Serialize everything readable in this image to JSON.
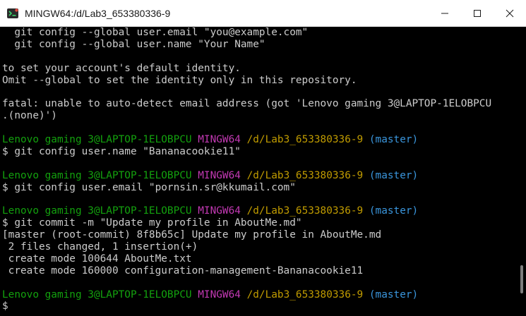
{
  "window": {
    "title": "MINGW64:/d/Lab3_653380336-9"
  },
  "terminal": {
    "lines": [
      {
        "text": "  git config --global user.email \"you@example.com\""
      },
      {
        "text": "  git config --global user.name \"Your Name\""
      },
      {
        "text": ""
      },
      {
        "text": "to set your account's default identity."
      },
      {
        "text": "Omit --global to set the identity only in this repository."
      },
      {
        "text": ""
      },
      {
        "text": "fatal: unable to auto-detect email address (got 'Lenovo gaming 3@LAPTOP-1ELOBPCU"
      },
      {
        "text": ".(none)')"
      },
      {
        "text": ""
      },
      {
        "prompt": {
          "user": "Lenovo gaming 3@LAPTOP-1ELOBPCU",
          "system": "MINGW64",
          "path": "/d/Lab3_653380336-9",
          "branch": "(master)"
        }
      },
      {
        "text": "$ git config user.name \"Bananacookie11\""
      },
      {
        "text": ""
      },
      {
        "prompt": {
          "user": "Lenovo gaming 3@LAPTOP-1ELOBPCU",
          "system": "MINGW64",
          "path": "/d/Lab3_653380336-9",
          "branch": "(master)"
        }
      },
      {
        "text": "$ git config user.email \"pornsin.sr@kkumail.com\""
      },
      {
        "text": ""
      },
      {
        "prompt": {
          "user": "Lenovo gaming 3@LAPTOP-1ELOBPCU",
          "system": "MINGW64",
          "path": "/d/Lab3_653380336-9",
          "branch": "(master)"
        }
      },
      {
        "text": "$ git commit -m \"Update my profile in AboutMe.md\""
      },
      {
        "text": "[master (root-commit) 8f8b65c] Update my profile in AboutMe.md"
      },
      {
        "text": " 2 files changed, 1 insertion(+)"
      },
      {
        "text": " create mode 100644 AboutMe.txt"
      },
      {
        "text": " create mode 160000 configuration-management-Bananacookie11"
      },
      {
        "text": ""
      },
      {
        "prompt": {
          "user": "Lenovo gaming 3@LAPTOP-1ELOBPCU",
          "system": "MINGW64",
          "path": "/d/Lab3_653380336-9",
          "branch": "(master)"
        }
      },
      {
        "text": "$"
      }
    ]
  },
  "colors": {
    "background": "#000000",
    "foreground": "#cccccc",
    "user": "#13a10e",
    "system": "#c239b3",
    "path": "#c19c00",
    "branch": "#3a96dd"
  },
  "icons": {
    "app": "mingw-terminal-icon",
    "minimize": "minimize-icon",
    "maximize": "maximize-icon",
    "close": "close-icon"
  }
}
